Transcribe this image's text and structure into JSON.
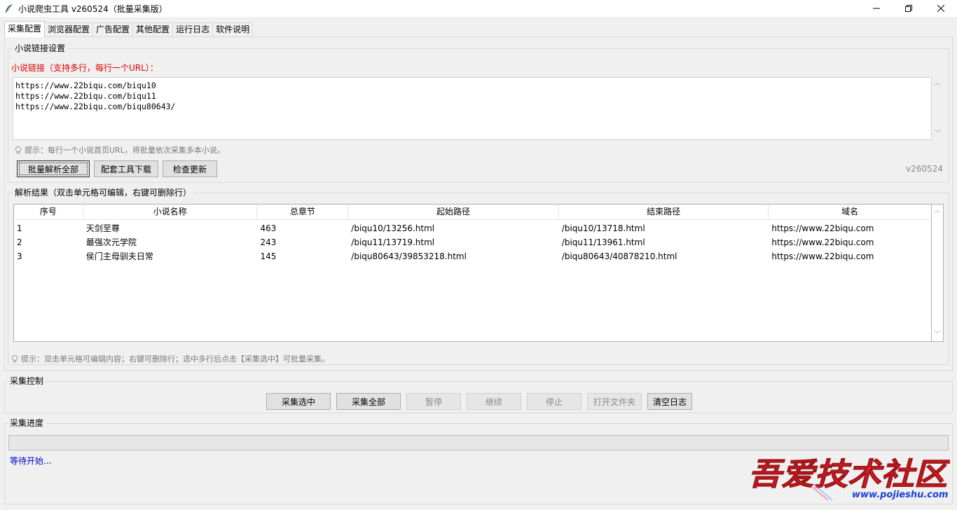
{
  "window": {
    "title": "小说爬虫工具 v260524（批量采集版）",
    "minimize_glyph": "—",
    "maximize_glyph": "❐",
    "close_glyph": "✕"
  },
  "tabs": [
    {
      "label": "采集配置",
      "active": true
    },
    {
      "label": "浏览器配置"
    },
    {
      "label": "广告配置"
    },
    {
      "label": "其他配置"
    },
    {
      "label": "运行日志"
    },
    {
      "label": "软件说明"
    }
  ],
  "link_group": {
    "title": "小说链接设置",
    "label": "小说链接（支持多行，每行一个URL）：",
    "urls": [
      "https://www.22biqu.com/biqu10",
      "https://www.22biqu.com/biqu11",
      "https://www.22biqu.com/biqu80643/"
    ],
    "hint": "提示：每行一个小说首页URL，将批量依次采集多本小说。",
    "buttons": {
      "parse_all": "批量解析全部",
      "download_tool": "配套工具下载",
      "check_update": "检查更新"
    },
    "version": "v260524"
  },
  "result_group": {
    "title": "解析结果（双击单元格可编辑，右键可删除行）",
    "columns": [
      "序号",
      "小说名称",
      "总章节",
      "起始路径",
      "结束路径",
      "域名"
    ],
    "rows": [
      [
        "1",
        "天剑至尊",
        "463",
        "/biqu10/13256.html",
        "/biqu10/13718.html",
        "https://www.22biqu.com"
      ],
      [
        "2",
        "最强次元学院",
        "243",
        "/biqu11/13719.html",
        "/biqu11/13961.html",
        "https://www.22biqu.com"
      ],
      [
        "3",
        "侯门主母驯夫日常",
        "145",
        "/biqu80643/39853218.html",
        "/biqu80643/40878210.html",
        "https://www.22biqu.com"
      ]
    ],
    "hint": "提示：双击单元格可编辑内容；右键可删除行；选中多行后点击【采集选中】可批量采集。"
  },
  "control_group": {
    "title": "采集控制",
    "buttons": {
      "collect_selected": "采集选中",
      "collect_all": "采集全部",
      "pause": "暂停",
      "resume": "继续",
      "stop": "停止",
      "open_folder": "打开文件夹",
      "clear_log": "清空日志"
    }
  },
  "progress_group": {
    "title": "采集进度",
    "progress": 0,
    "status": "等待开始..."
  },
  "watermark": {
    "text": "吾爱技术社区",
    "url": "www.pojieshu.com"
  },
  "colors": {
    "red_label": "#e00000",
    "status_blue": "#0000cc",
    "watermark_red": "#e8262c",
    "watermark_blue": "#1a3fd6"
  }
}
